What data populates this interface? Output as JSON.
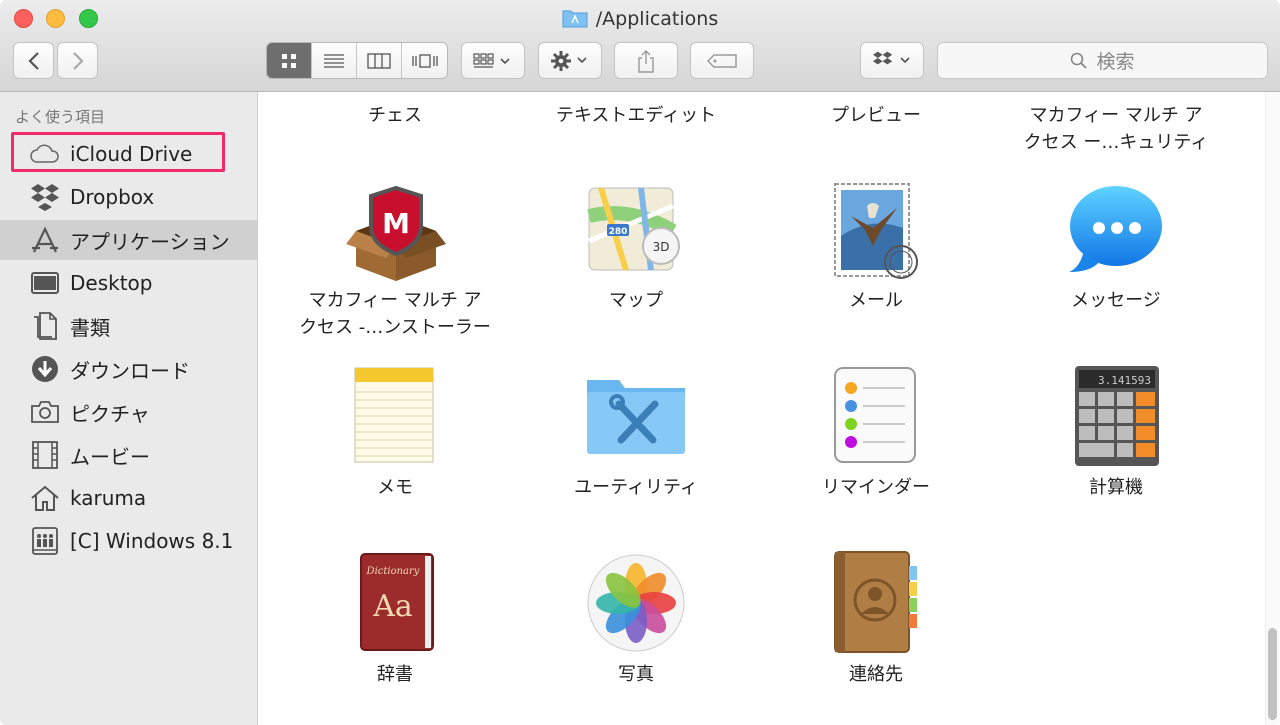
{
  "window": {
    "title": "/Applications"
  },
  "toolbar": {
    "back": "‹",
    "forward": "›",
    "search_placeholder": "検索"
  },
  "sidebar": {
    "header": "よく使う項目",
    "items": [
      {
        "label": "iCloud Drive",
        "icon": "cloud-icon"
      },
      {
        "label": "Dropbox",
        "icon": "dropbox-icon"
      },
      {
        "label": "アプリケーション",
        "icon": "applications-icon"
      },
      {
        "label": "Desktop",
        "icon": "desktop-icon"
      },
      {
        "label": "書類",
        "icon": "documents-icon"
      },
      {
        "label": "ダウンロード",
        "icon": "download-icon"
      },
      {
        "label": "ピクチャ",
        "icon": "camera-icon"
      },
      {
        "label": "ムービー",
        "icon": "film-icon"
      },
      {
        "label": "karuma",
        "icon": "home-icon"
      },
      {
        "label": "[C] Windows 8.1",
        "icon": "disk-icon"
      }
    ]
  },
  "files": {
    "row0": [
      "チェス",
      "テキストエディット",
      "プレビュー",
      "マカフィー マルチ ア",
      "クセス ー…キュリティ"
    ],
    "row1": [
      "マカフィー マルチ ア",
      "クセス -…ンストーラー",
      "マップ",
      "メール",
      "メッセージ"
    ],
    "row2": [
      "メモ",
      "ユーティリティ",
      "リマインダー",
      "計算機"
    ],
    "row3": [
      "辞書",
      "写真",
      "連絡先"
    ]
  },
  "icon_text": {
    "maps_badge": "280",
    "maps_3d": "3D",
    "calc_display": "3.141593",
    "dict_title": "Dictionary",
    "dict_letters": "Aa",
    "mcafee_letter": "M"
  },
  "colors": {
    "highlight": "#ef2b6a",
    "sidebar_bg": "#eaeaea",
    "selected_row": "#d0d0d0"
  }
}
